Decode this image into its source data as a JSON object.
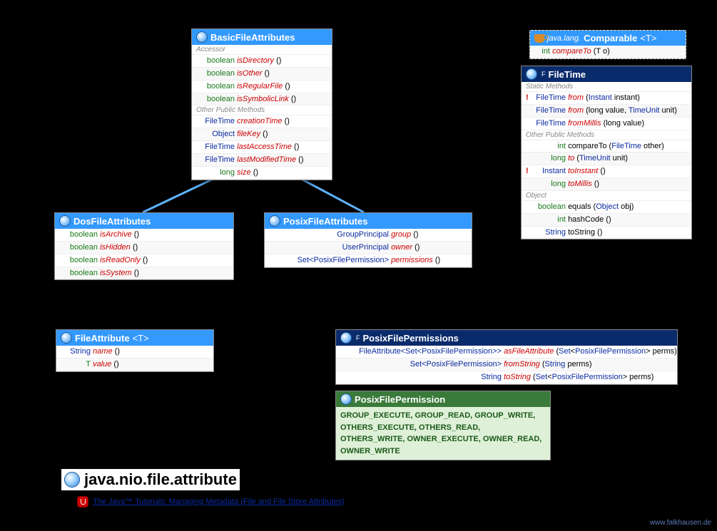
{
  "basic": {
    "title": "BasicFileAttributes",
    "sec1": "Accessor",
    "rows1": [
      {
        "t": "boolean",
        "m": "isDirectory",
        "p": "()"
      },
      {
        "t": "boolean",
        "m": "isOther",
        "p": "()"
      },
      {
        "t": "boolean",
        "m": "isRegularFile",
        "p": "()"
      },
      {
        "t": "boolean",
        "m": "isSymbolicLink",
        "p": "()"
      }
    ],
    "sec2": "Other Public Methods",
    "rows2": [
      {
        "t": "FileTime",
        "m": "creationTime",
        "p": "()"
      },
      {
        "t": "Object",
        "m": "fileKey",
        "p": "()"
      },
      {
        "t": "FileTime",
        "m": "lastAccessTime",
        "p": "()"
      },
      {
        "t": "FileTime",
        "m": "lastModifiedTime",
        "p": "()"
      },
      {
        "t": "long",
        "m": "size",
        "p": "()"
      }
    ]
  },
  "dos": {
    "title": "DosFileAttributes",
    "rows": [
      {
        "t": "boolean",
        "m": "isArchive",
        "p": "()"
      },
      {
        "t": "boolean",
        "m": "isHidden",
        "p": "()"
      },
      {
        "t": "boolean",
        "m": "isReadOnly",
        "p": "()"
      },
      {
        "t": "boolean",
        "m": "isSystem",
        "p": "()"
      }
    ]
  },
  "posix": {
    "title": "PosixFileAttributes",
    "rows": [
      {
        "t": "GroupPrincipal",
        "m": "group",
        "p": "()"
      },
      {
        "t": "UserPrincipal",
        "m": "owner",
        "p": "()"
      },
      {
        "t": "Set<PosixFilePermission>",
        "m": "permissions",
        "p": "()"
      }
    ]
  },
  "comparable": {
    "pkg": "java.lang.",
    "title": "Comparable",
    "generic": "<T>",
    "row": {
      "t": "int",
      "m": "compareTo",
      "p": "(T o)"
    }
  },
  "filetime": {
    "title": "FileTime",
    "sec1": "Static Methods",
    "rows1": [
      {
        "excl": "!",
        "t": "FileTime",
        "m": "from",
        "p": "(Instant instant)",
        "tk": false
      },
      {
        "excl": "",
        "t": "FileTime",
        "m": "from",
        "p": "(long value, TimeUnit unit)",
        "tk": false
      },
      {
        "excl": "",
        "t": "FileTime",
        "m": "fromMillis",
        "p": "(long value)",
        "tk": false
      }
    ],
    "sec2": "Other Public Methods",
    "rows2": [
      {
        "excl": "",
        "t": "int",
        "m": "compareTo",
        "p": "(FileTime other)",
        "tk": true,
        "red": false
      },
      {
        "excl": "",
        "t": "long",
        "m": "to",
        "p": "(TimeUnit unit)",
        "tk": true,
        "red": true
      },
      {
        "excl": "!",
        "t": "Instant",
        "m": "toInstant",
        "p": "()",
        "tk": false,
        "red": true
      },
      {
        "excl": "",
        "t": "long",
        "m": "toMillis",
        "p": "()",
        "tk": true,
        "red": true
      }
    ],
    "sec3": "Object",
    "rows3": [
      {
        "t": "boolean",
        "m": "equals",
        "p": "(Object obj)",
        "tk": true
      },
      {
        "t": "int",
        "m": "hashCode",
        "p": "()",
        "tk": true
      },
      {
        "t": "String",
        "m": "toString",
        "p": "()",
        "tk": false
      }
    ]
  },
  "fileattr": {
    "title": "FileAttribute",
    "generic": "<T>",
    "rows": [
      {
        "t": "String",
        "m": "name",
        "p": "()"
      },
      {
        "t": "T",
        "m": "value",
        "p": "()"
      }
    ]
  },
  "perms": {
    "title": "PosixFilePermissions",
    "rows": [
      {
        "t": "FileAttribute<Set<PosixFilePermission>>",
        "m": "asFileAttribute",
        "p": "(Set<PosixFilePermission> perms)"
      },
      {
        "t": "Set<PosixFilePermission>",
        "m": "fromString",
        "p": "(String perms)"
      },
      {
        "t": "String",
        "m": "toString",
        "p": "(Set<PosixFilePermission> perms)"
      }
    ]
  },
  "permenum": {
    "title": "PosixFilePermission",
    "values": "GROUP_EXECUTE, GROUP_READ, GROUP_WRITE, OTHERS_EXECUTE, OTHERS_READ, OTHERS_WRITE, OWNER_EXECUTE, OWNER_READ, OWNER_WRITE"
  },
  "pkg": "java.nio.file.attribute",
  "tutorial": "The Java™ Tutorials: Managing Metadata (File and File Store Attributes)",
  "footer": "www.falkhausen.de"
}
